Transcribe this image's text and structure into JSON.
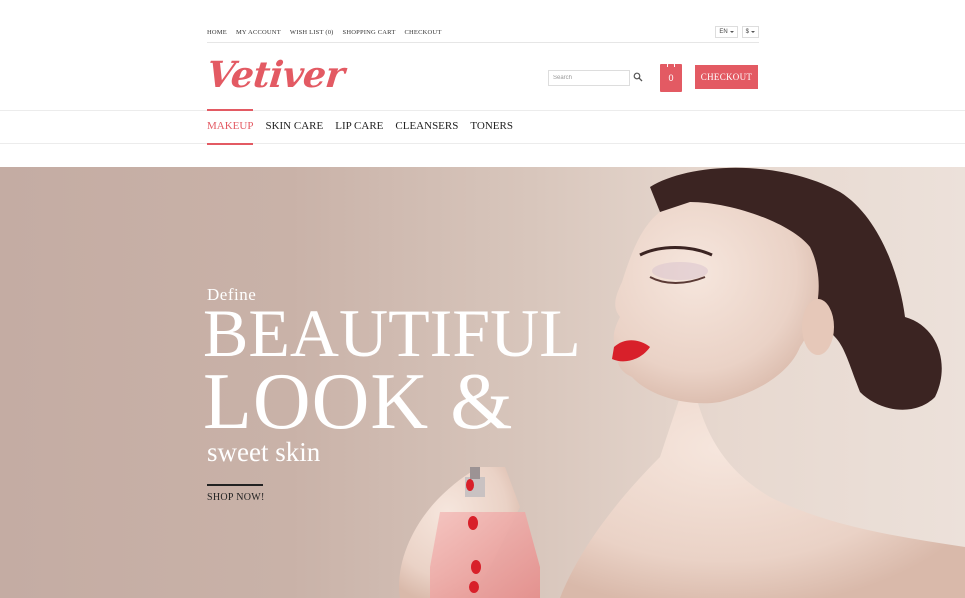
{
  "top_links": [
    "HOME",
    "MY ACCOUNT",
    "WISH LIST (0)",
    "SHOPPING CART",
    "CHECKOUT"
  ],
  "language": "EN",
  "currency": "$",
  "logo_text": "Vetiver",
  "search": {
    "placeholder": "Search"
  },
  "cart_count": "0",
  "checkout_button": "CHECKOUT",
  "nav": [
    "MAKEUP",
    "SKIN CARE",
    "LIP CARE",
    "CLEANSERS",
    "TONERS"
  ],
  "nav_active_index": 0,
  "hero": {
    "subtitle": "Define",
    "line1": "BEAUTIFUL",
    "line2": "LOOK &",
    "line3": "sweet skin",
    "cta": "SHOP NOW!"
  },
  "colors": {
    "accent": "#e35a63",
    "hero_bg": "#c9b2a8"
  },
  "icons": {
    "search": "search-icon",
    "cart": "shopping-bag-icon",
    "caret": "chevron-down-icon"
  }
}
